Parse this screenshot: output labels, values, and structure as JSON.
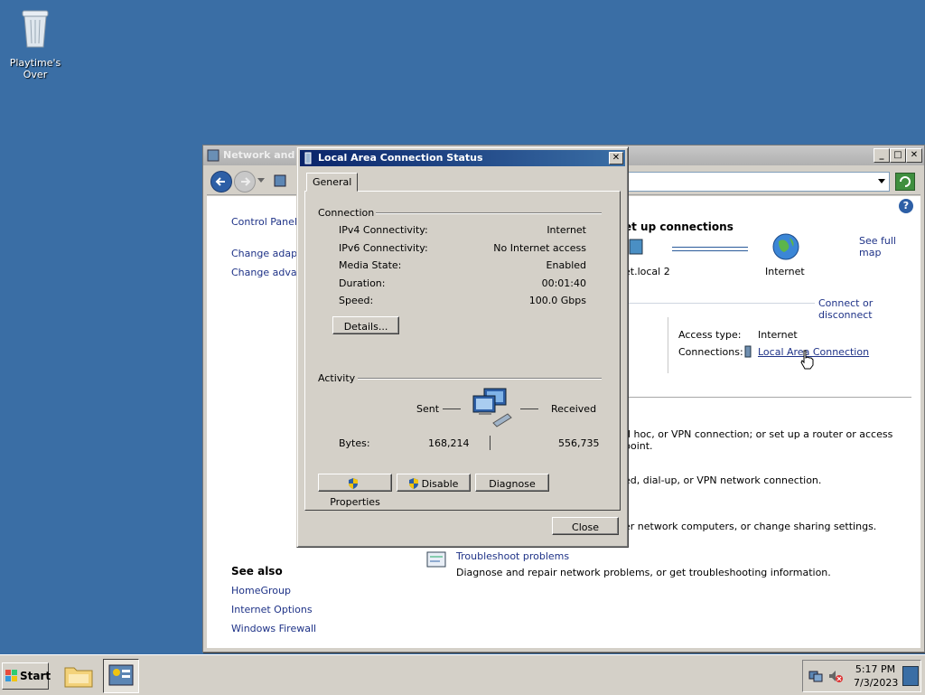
{
  "desktop": {
    "recycle_label": "Playtime's Over"
  },
  "bg_window": {
    "title": "Network and S",
    "left_links": [
      "Control Panel H",
      "Change adapte",
      "Change advanc"
    ],
    "see_also": {
      "heading": "See also",
      "links": [
        "HomeGroup",
        "Internet Options",
        "Windows Firewall"
      ]
    },
    "setup_heading": "et up connections",
    "see_full_map": "See full map",
    "map_node_network": "et.local  2",
    "map_node_internet": "Internet",
    "connect_disconnect": "Connect or disconnect",
    "access_type_label": "Access type:",
    "access_type_value": "Internet",
    "connections_label": "Connections:",
    "connections_value": "Local Area Connection",
    "task_text_1": "d hoc, or VPN connection; or set up a router or access point.",
    "task_text_2": "ed, dial-up, or VPN network connection.",
    "task_text_3": "er network computers, or change sharing settings.",
    "troubleshoot_title": "Troubleshoot problems",
    "troubleshoot_desc": "Diagnose and repair network problems, or get troubleshooting information."
  },
  "dialog": {
    "title": "Local Area Connection Status",
    "tab": "General",
    "connection_heading": "Connection",
    "rows": [
      {
        "label": "IPv4 Connectivity:",
        "value": "Internet"
      },
      {
        "label": "IPv6 Connectivity:",
        "value": "No Internet access"
      },
      {
        "label": "Media State:",
        "value": "Enabled"
      },
      {
        "label": "Duration:",
        "value": "00:01:40"
      },
      {
        "label": "Speed:",
        "value": "100.0 Gbps"
      }
    ],
    "details_button": "Details...",
    "activity_heading": "Activity",
    "sent_label": "Sent",
    "received_label": "Received",
    "bytes_label": "Bytes:",
    "bytes_sent": "168,214",
    "bytes_received": "556,735",
    "properties_button": "Properties",
    "disable_button": "Disable",
    "diagnose_button": "Diagnose",
    "close_button": "Close"
  },
  "taskbar": {
    "start_label": "Start",
    "time": "5:17 PM",
    "date": "7/3/2023"
  }
}
